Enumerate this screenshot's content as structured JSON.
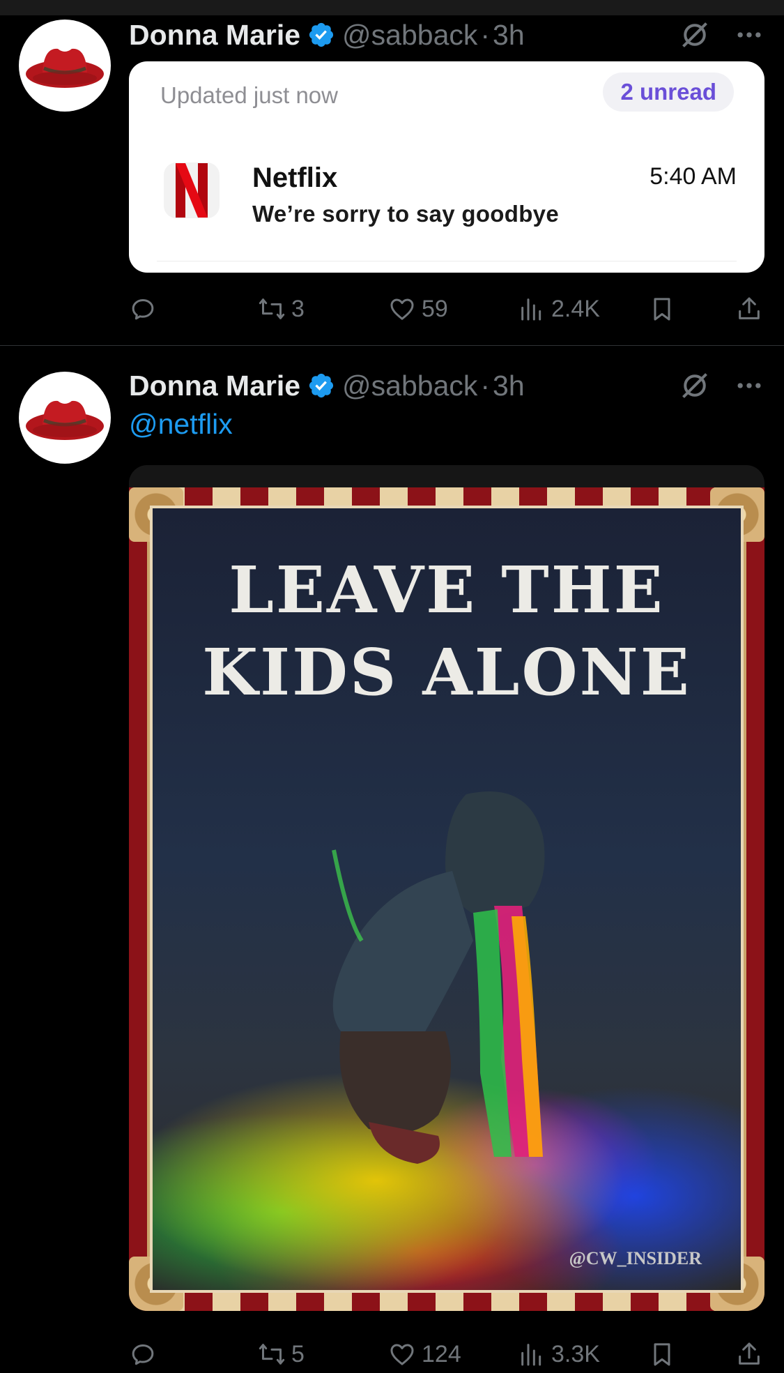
{
  "tweets": [
    {
      "author": {
        "name": "Donna Marie",
        "handle": "@sabback",
        "time": "3h"
      },
      "notification": {
        "updated": "Updated just now",
        "unread": "2 unread",
        "app": "Netflix",
        "message": "We’re sorry to say goodbye",
        "time": "5:40 AM"
      },
      "actions": {
        "replies": "",
        "reposts": "3",
        "likes": "59",
        "views": "2.4K"
      }
    },
    {
      "author": {
        "name": "Donna Marie",
        "handle": "@sabback",
        "time": "3h"
      },
      "mention": "@netflix",
      "media": {
        "title_line1": "LEAVE THE",
        "title_line2": "KIDS ALONE",
        "watermark": "@CW_INSIDER"
      },
      "actions": {
        "replies": "",
        "reposts": "5",
        "likes": "124",
        "views": "3.3K"
      }
    }
  ],
  "separator": "·",
  "colors": {
    "accent": "#1d9bf0",
    "muted": "#71767b",
    "unread": "#6a4fd8",
    "netflix": "#e50914"
  }
}
